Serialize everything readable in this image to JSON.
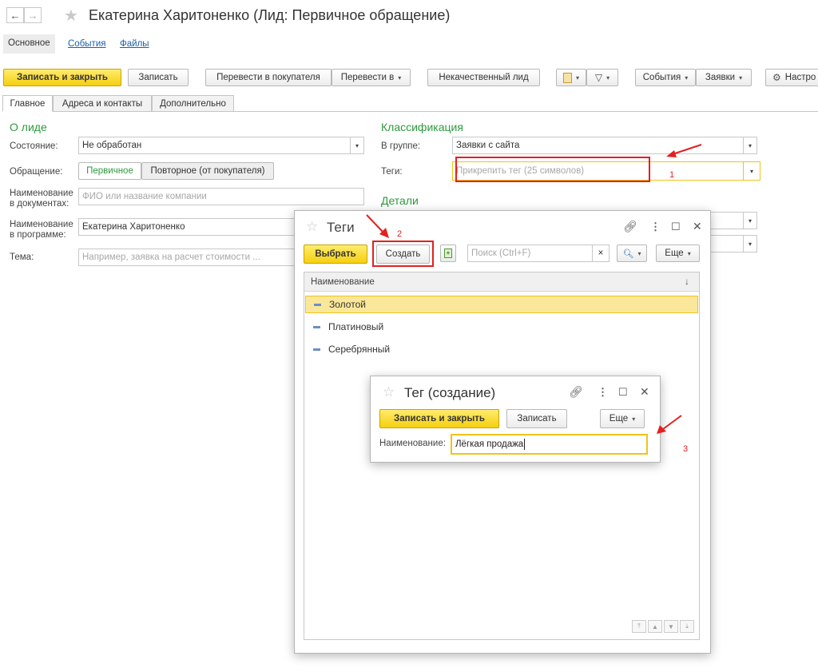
{
  "window": {
    "title": "Екатерина Харитоненко (Лид: Первичное обращение)"
  },
  "sections": {
    "main": "Основное",
    "events": "События",
    "files": "Файлы"
  },
  "toolbar": {
    "save_close": "Записать и закрыть",
    "save": "Записать",
    "to_customer": "Перевести в покупателя",
    "move_to": "Перевести в",
    "bad_lead": "Некачественный лид",
    "events_btn": "События",
    "requests_btn": "Заявки",
    "settings": "Настро"
  },
  "tabs": [
    "Главное",
    "Адреса и контакты",
    "Дополнительно"
  ],
  "lead": {
    "group_title": "О лиде",
    "state_label": "Состояние:",
    "state_value": "Не обработан",
    "appeal_label": "Обращение:",
    "appeal_primary": "Первичное",
    "appeal_repeat": "Повторное (от покупателя)",
    "docname_label_1": "Наименование",
    "docname_label_2": "в документах:",
    "docname_placeholder": "ФИО или название компании",
    "progname_label_1": "Наименование",
    "progname_label_2": "в программе:",
    "progname_value": "Екатерина Харитоненко",
    "topic_label": "Тема:",
    "topic_placeholder": "Например, заявка на расчет стоимости ..."
  },
  "classification": {
    "group_title": "Классификация",
    "group_label": "В группе:",
    "group_value": "Заявки с сайта",
    "tags_label": "Теги:",
    "tags_placeholder": "Прикрепить тег (25 символов)"
  },
  "details": {
    "group_title": "Детали"
  },
  "tags_window": {
    "title": "Теги",
    "select_btn": "Выбрать",
    "create_btn": "Создать",
    "search_placeholder": "Поиск (Ctrl+F)",
    "clear": "×",
    "more": "Еще",
    "column_header": "Наименование",
    "sort_icon": "↓",
    "rows": [
      "Золотой",
      "Платиновый",
      "Серебрянный"
    ]
  },
  "tag_create_window": {
    "title": "Тег (создание)",
    "save_close": "Записать и закрыть",
    "save": "Записать",
    "more": "Еще",
    "name_label": "Наименование:",
    "name_value": "Лёгкая продажа"
  },
  "annotations": [
    "1",
    "2",
    "3"
  ],
  "colors": {
    "accent_yellow": "#f5cf10",
    "green_title": "#2e9a3e",
    "link_blue": "#1a5fa8",
    "annotation_red": "#e32020",
    "selected_row": "#fbe79a"
  }
}
